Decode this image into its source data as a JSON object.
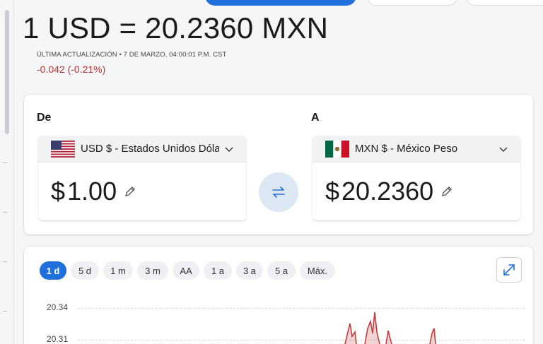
{
  "rate_header": {
    "title": "1 USD = 20.2360 MXN",
    "updated": "ÚLTIMA ACTUALIZACIÓN • 7 DE MARZO, 04:00:01 P.M. CST",
    "change": "-0.042 (-0.21%)"
  },
  "converter": {
    "from_label": "De",
    "to_label": "A",
    "from": {
      "currency": "USD $ - Estados Unidos Dólar",
      "symbol": "$",
      "amount": "1.00",
      "flag": "us-flag-icon"
    },
    "to": {
      "currency": "MXN $ - México Peso",
      "symbol": "$",
      "amount": "20.2360",
      "flag": "mx-flag-icon"
    }
  },
  "chart_controls": {
    "ranges": [
      "1 d",
      "5 d",
      "1 m",
      "3 m",
      "AA",
      "1 a",
      "3 a",
      "5 a",
      "Máx."
    ],
    "active_range": "1 d"
  },
  "chart_data": {
    "type": "area",
    "y_ticks": [
      "20.34",
      "20.31"
    ],
    "series_color": "#c43c3c"
  },
  "colors": {
    "accent": "#1f6fdc",
    "negative": "#c62f2f"
  }
}
